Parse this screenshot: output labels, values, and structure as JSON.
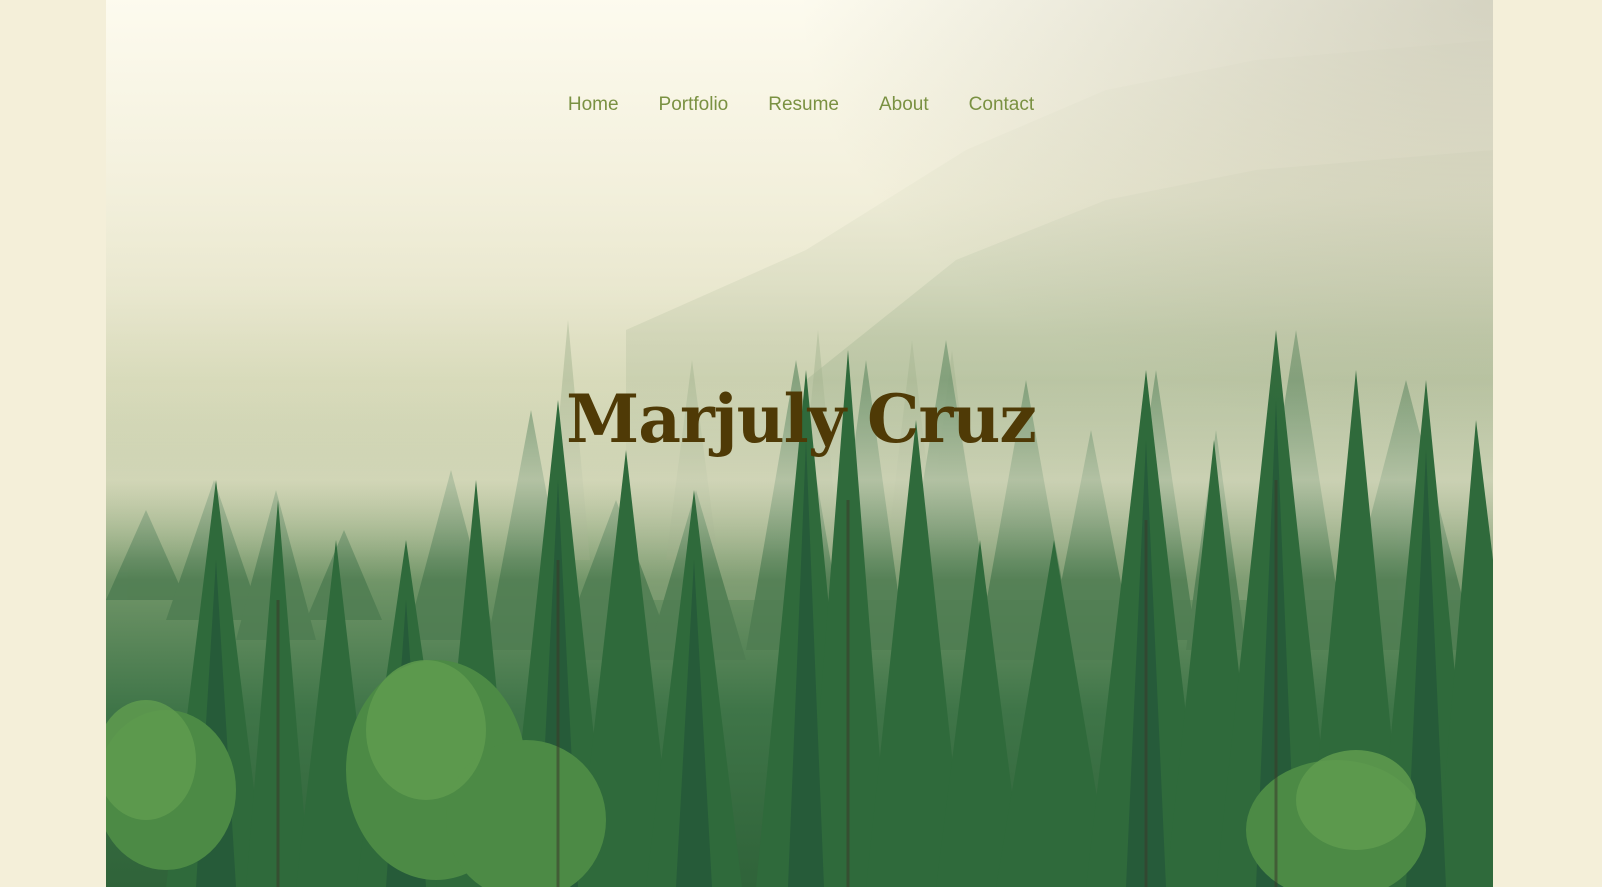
{
  "nav": {
    "items": [
      {
        "label": "Home"
      },
      {
        "label": "Portfolio"
      },
      {
        "label": "Resume"
      },
      {
        "label": "About"
      },
      {
        "label": "Contact"
      }
    ]
  },
  "hero": {
    "title": "Marjuly Cruz",
    "background": "misty-pine-forest-image"
  },
  "colors": {
    "page_background": "#f4efd9",
    "nav_link": "#7a9142",
    "title": "#4f3a06"
  }
}
